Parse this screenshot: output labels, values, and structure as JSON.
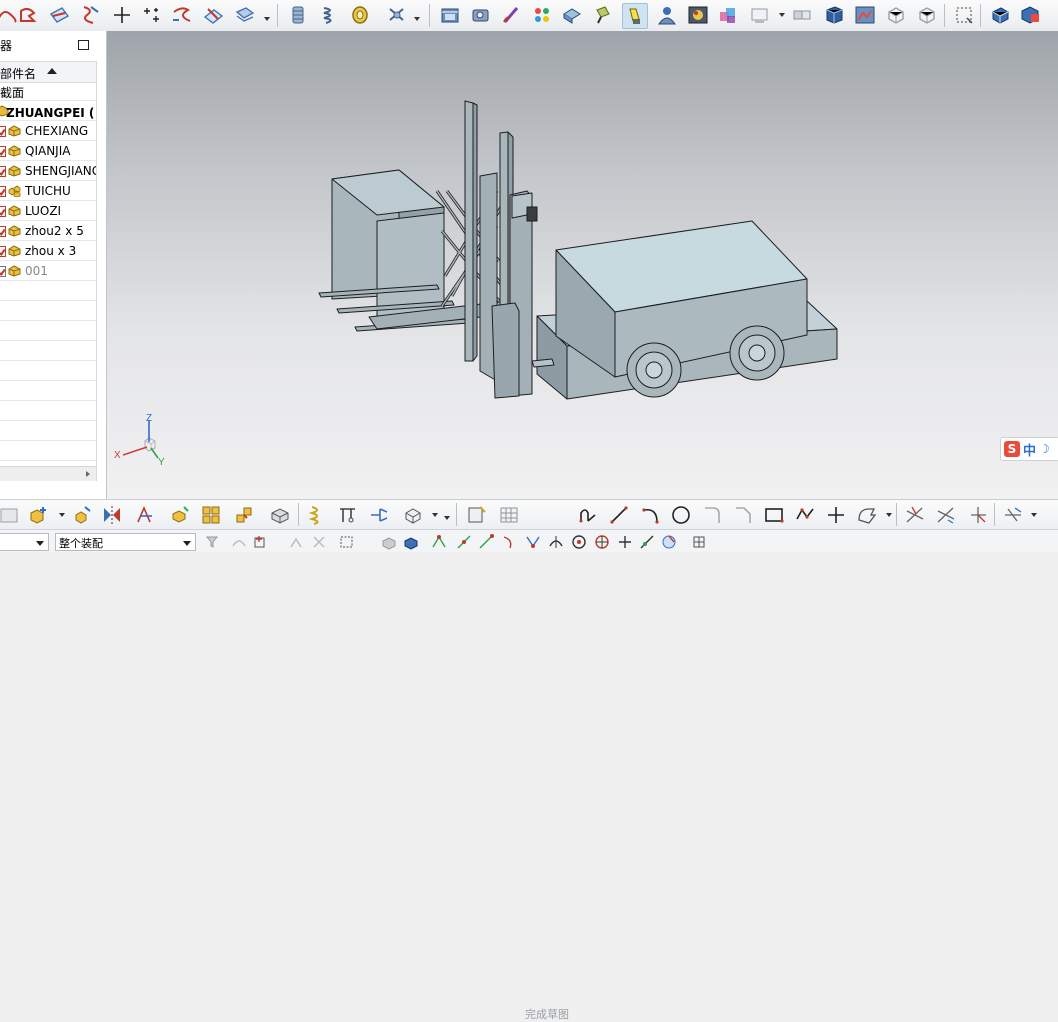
{
  "navigator": {
    "title": "器",
    "column_header": "部件名",
    "rows": [
      {
        "label": "截面",
        "indent": "none"
      },
      {
        "label": "ZHUANGPEI ( 顺",
        "indent": "root"
      },
      {
        "label": "CHEXIANG",
        "indent": "child"
      },
      {
        "label": "QIANJIA",
        "indent": "child"
      },
      {
        "label": "SHENGJIANG",
        "indent": "child"
      },
      {
        "label": "TUICHU",
        "indent": "child"
      },
      {
        "label": "LUOZI",
        "indent": "child"
      },
      {
        "label": "zhou2 x 5",
        "indent": "child"
      },
      {
        "label": "zhou x 3",
        "indent": "child"
      },
      {
        "label": "001",
        "indent": "child"
      }
    ]
  },
  "sketch_toolbar": {
    "finish_sketch_label": "完成草图"
  },
  "status_bar": {
    "selection_filter_value": "",
    "assembly_scope_value": "整个装配"
  },
  "triad": {
    "x_label": "X",
    "y_label": "Y",
    "z_label": "Z"
  },
  "ime": {
    "logo": "S",
    "mode_label": "中",
    "moon_glyph": "☽"
  },
  "colors": {
    "model_face": "#a9b7bd",
    "model_top": "#c3d6dd",
    "model_edge": "#1c1e20",
    "accent": "#2a6fd1"
  },
  "icons": {
    "top_toolbar": [
      "sketch-icon",
      "curve-icon",
      "edit-face-icon",
      "offset-icon",
      "point-icon",
      "point-set-icon",
      "spline-icon",
      "surface-icon",
      "sweep-icon",
      "bolt-icon",
      "spring-icon",
      "gear-icon",
      "rotation-icon",
      "movie-icon",
      "camera-icon",
      "brush-icon",
      "palette-icon",
      "material-icon",
      "lamp-icon",
      "highlight-icon",
      "person-icon",
      "environment-icon",
      "color-icon",
      "window-icon",
      "part-icon",
      "blue-cube-icon",
      "image-icon",
      "tools-icon",
      "snapshot-icon",
      "frame-icon",
      "view-cube-icon",
      "save-view-icon"
    ],
    "bottom_toolbar": [
      "image-icon",
      "add-component-icon",
      "new-component-icon",
      "mirror-icon",
      "constraint-icon",
      "explode-icon",
      "pattern-icon",
      "reposition-icon",
      "sketch-box-icon",
      "spring-icon",
      "wave-icon",
      "assembly-tool-icon",
      "move-icon",
      "sketch-icon",
      "grid-icon",
      "profile-icon",
      "line-icon",
      "arc-icon",
      "circle-icon",
      "fillet-icon",
      "chamfer-icon",
      "rectangle-icon",
      "polygon-icon",
      "point-icon",
      "offset-icon",
      "trim-icon",
      "extend-icon",
      "corner-icon",
      "mirror-curve-icon"
    ]
  }
}
